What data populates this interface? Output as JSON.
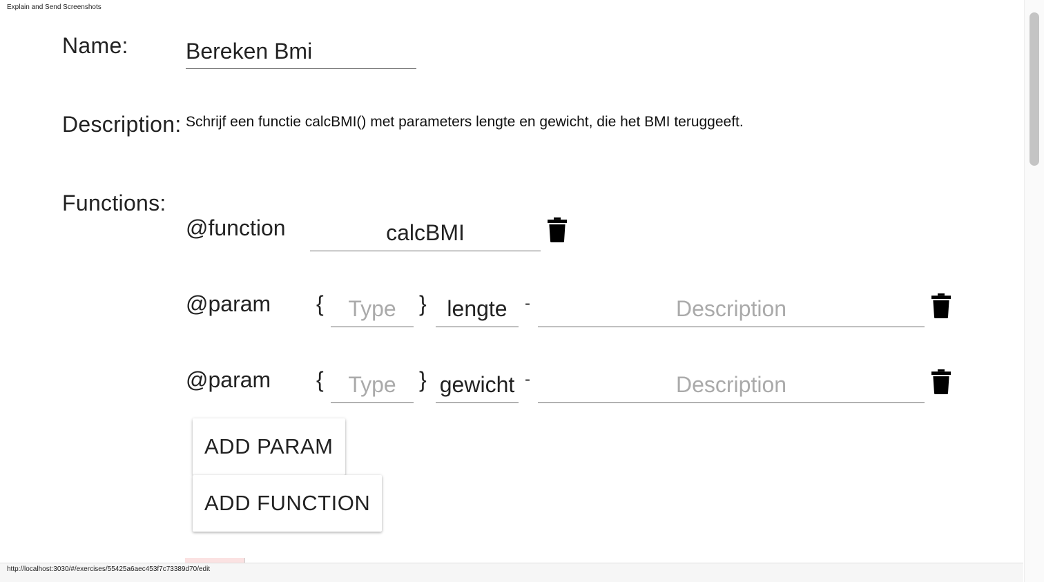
{
  "app": {
    "caption": "Explain and Send Screenshots"
  },
  "form": {
    "name_label": "Name:",
    "name_value": "Bereken Bmi",
    "description_label": "Description:",
    "description_text": "Schrijf een functie calcBMI() met parameters lengte en gewicht, die het BMI teruggeeft.",
    "functions_label": "Functions:"
  },
  "function": {
    "tag": "@function",
    "name_value": "calcBMI",
    "delete_icon": "trash-icon"
  },
  "params": [
    {
      "tag": "@param",
      "open_brace": "{",
      "type_placeholder": "Type",
      "close_brace": "}",
      "name_value": "lengte",
      "dash": "-",
      "description_placeholder": "Description",
      "delete_icon": "trash-icon"
    },
    {
      "tag": "@param",
      "open_brace": "{",
      "type_placeholder": "Type",
      "close_brace": "}",
      "name_value": "gewicht",
      "dash": "-",
      "description_placeholder": "Description",
      "delete_icon": "trash-icon"
    }
  ],
  "buttons": {
    "add_param": "ADD PARAM",
    "add_function": "ADD FUNCTION"
  },
  "status_bar": {
    "url": "http://localhost:3030/#/exercises/55425a6aec453f7c73389d70/edit"
  }
}
